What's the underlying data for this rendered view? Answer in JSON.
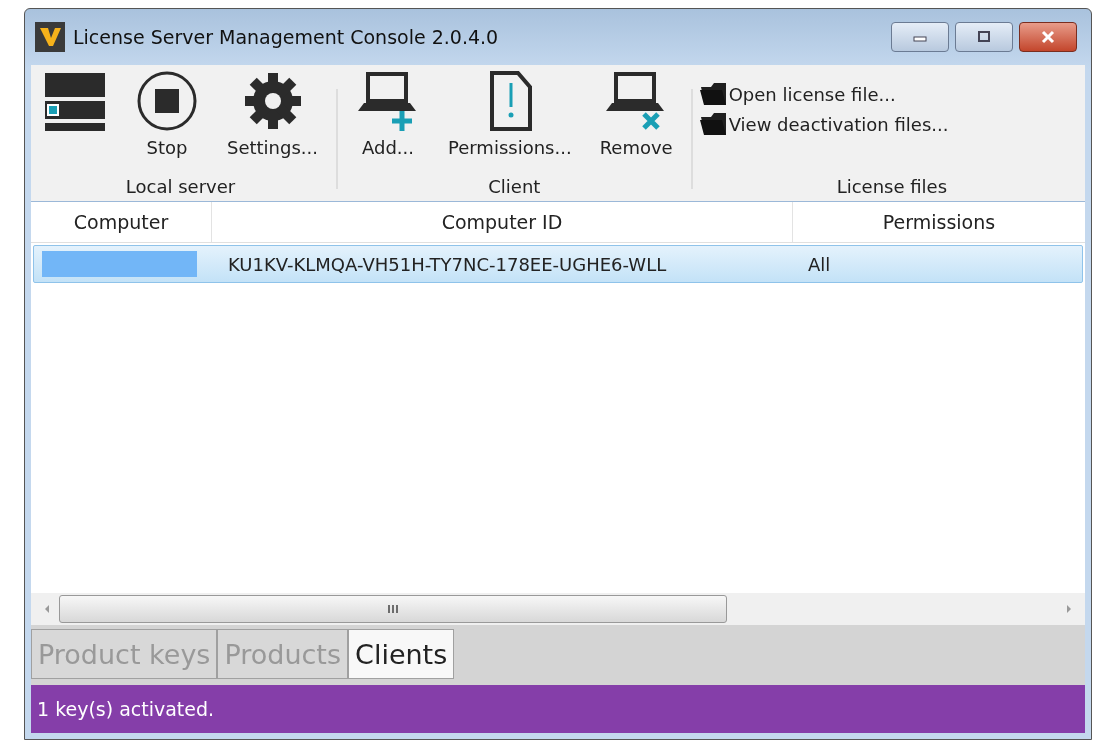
{
  "window": {
    "title": "License Server Management Console 2.0.4.0"
  },
  "toolbar": {
    "groups": [
      {
        "label": "Local server",
        "buttons": [
          {
            "kind": "server"
          },
          {
            "kind": "stop",
            "label": "Stop"
          },
          {
            "kind": "settings",
            "label": "Settings..."
          }
        ]
      },
      {
        "label": "Client",
        "buttons": [
          {
            "kind": "add",
            "label": "Add..."
          },
          {
            "kind": "permissions",
            "label": "Permissions..."
          },
          {
            "kind": "remove",
            "label": "Remove"
          }
        ]
      }
    ],
    "license_files": {
      "label": "License files",
      "links": [
        "Open license file...",
        "View deactivation files..."
      ]
    }
  },
  "table": {
    "columns": [
      "Computer",
      "Computer ID",
      "Permissions"
    ],
    "rows": [
      {
        "computer_hidden": true,
        "computer_id": "KU1KV-KLMQA-VH51H-TY7NC-178EE-UGHE6-WLL",
        "permissions": "All",
        "selected": true
      }
    ]
  },
  "tabs": [
    {
      "label": "Product keys",
      "selected": false
    },
    {
      "label": "Products",
      "selected": false
    },
    {
      "label": "Clients",
      "selected": true
    }
  ],
  "status_bar": "1 key(s) activated."
}
